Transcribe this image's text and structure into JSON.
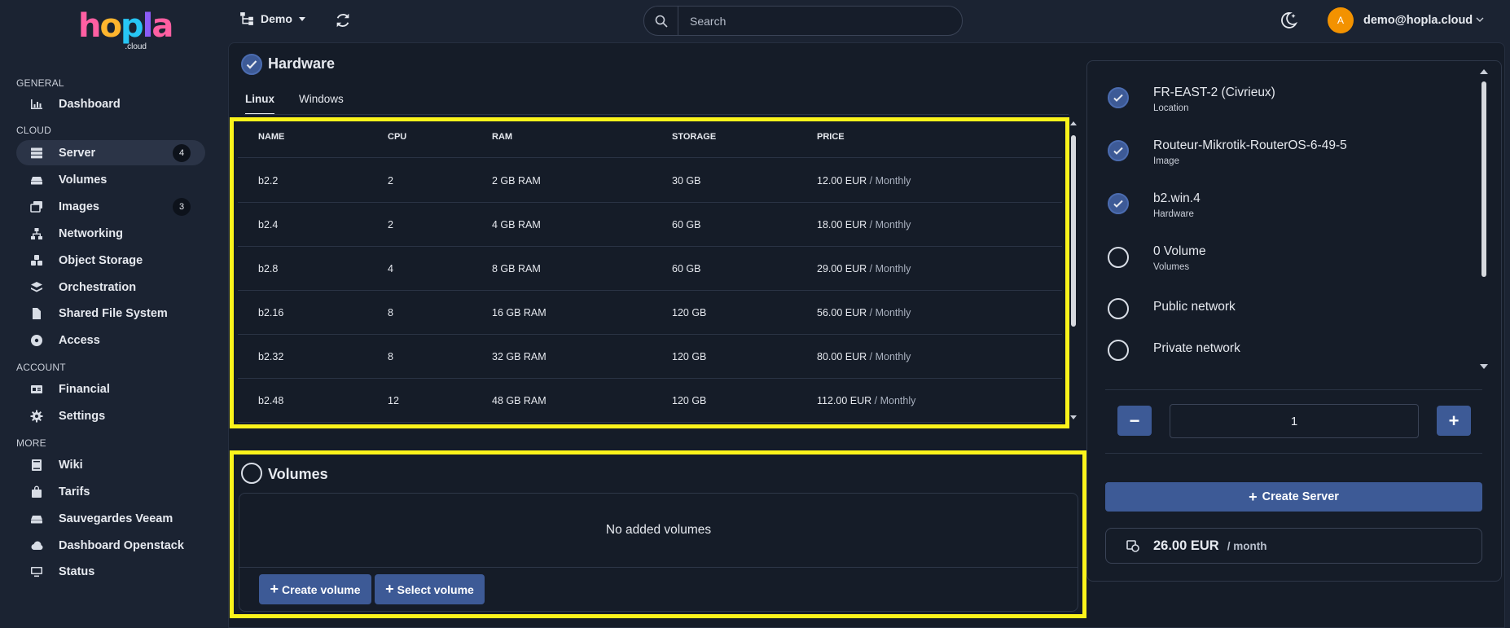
{
  "app": {
    "logo_text": "hopla",
    "logo_sub": ".cloud"
  },
  "sidebar": {
    "sections": {
      "general": "GENERAL",
      "cloud": "CLOUD",
      "account": "ACCOUNT",
      "more": "MORE"
    },
    "items": [
      {
        "label": "Dashboard",
        "icon": "chart-icon"
      },
      {
        "label": "Server",
        "icon": "server-icon",
        "badge": "4",
        "active": true
      },
      {
        "label": "Volumes",
        "icon": "drive-icon"
      },
      {
        "label": "Images",
        "icon": "images-icon",
        "badge": "3"
      },
      {
        "label": "Networking",
        "icon": "network-icon"
      },
      {
        "label": "Object Storage",
        "icon": "boxes-icon"
      },
      {
        "label": "Orchestration",
        "icon": "layers-icon"
      },
      {
        "label": "Shared File System",
        "icon": "file-icon"
      },
      {
        "label": "Access",
        "icon": "disc-icon"
      },
      {
        "label": "Financial",
        "icon": "id-card-icon"
      },
      {
        "label": "Settings",
        "icon": "gear-icon"
      },
      {
        "label": "Wiki",
        "icon": "book-icon"
      },
      {
        "label": "Tarifs",
        "icon": "bag-icon"
      },
      {
        "label": "Sauvegardes Veeam",
        "icon": "drive-icon"
      },
      {
        "label": "Dashboard Openstack",
        "icon": "cloud-icon"
      },
      {
        "label": "Status",
        "icon": "monitor-icon"
      }
    ]
  },
  "topbar": {
    "project": "Demo",
    "search_placeholder": "Search",
    "user_initial": "A",
    "user_email": "demo@hopla.cloud"
  },
  "hardware": {
    "title": "Hardware",
    "tabs": [
      "Linux",
      "Windows"
    ],
    "columns": [
      "NAME",
      "CPU",
      "RAM",
      "STORAGE",
      "PRICE"
    ],
    "rows": [
      {
        "name": "b2.2",
        "cpu": "2",
        "ram": "2 GB RAM",
        "storage": "30 GB",
        "price": "12.00 EUR",
        "period": "/ Monthly"
      },
      {
        "name": "b2.4",
        "cpu": "2",
        "ram": "4 GB RAM",
        "storage": "60 GB",
        "price": "18.00 EUR",
        "period": "/ Monthly"
      },
      {
        "name": "b2.8",
        "cpu": "4",
        "ram": "8 GB RAM",
        "storage": "60 GB",
        "price": "29.00 EUR",
        "period": "/ Monthly"
      },
      {
        "name": "b2.16",
        "cpu": "8",
        "ram": "16 GB RAM",
        "storage": "120 GB",
        "price": "56.00 EUR",
        "period": "/ Monthly"
      },
      {
        "name": "b2.32",
        "cpu": "8",
        "ram": "32 GB RAM",
        "storage": "120 GB",
        "price": "80.00 EUR",
        "period": "/ Monthly"
      },
      {
        "name": "b2.48",
        "cpu": "12",
        "ram": "48 GB RAM",
        "storage": "120 GB",
        "price": "112.00 EUR",
        "period": "/ Monthly"
      }
    ]
  },
  "volumes": {
    "title": "Volumes",
    "empty_text": "No added volumes",
    "create_label": "Create volume",
    "select_label": "Select volume"
  },
  "summary": {
    "steps": [
      {
        "value": "FR-EAST-2 (Civrieux)",
        "label": "Location",
        "done": true
      },
      {
        "value": "Routeur-Mikrotik-RouterOS-6-49-5",
        "label": "Image",
        "done": true
      },
      {
        "value": "b2.win.4",
        "label": "Hardware",
        "done": true
      },
      {
        "value": "0 Volume",
        "label": "Volumes",
        "done": false
      },
      {
        "value": "Public network",
        "label": "",
        "done": false
      },
      {
        "value": "Private network",
        "label": "",
        "done": false
      }
    ],
    "quantity": "1",
    "create_label": "Create Server",
    "total": "26.00 EUR",
    "per": "/ month"
  },
  "colors": {
    "accent": "#3d5a96",
    "highlight": "#fbf31b",
    "avatar": "#f39200"
  }
}
